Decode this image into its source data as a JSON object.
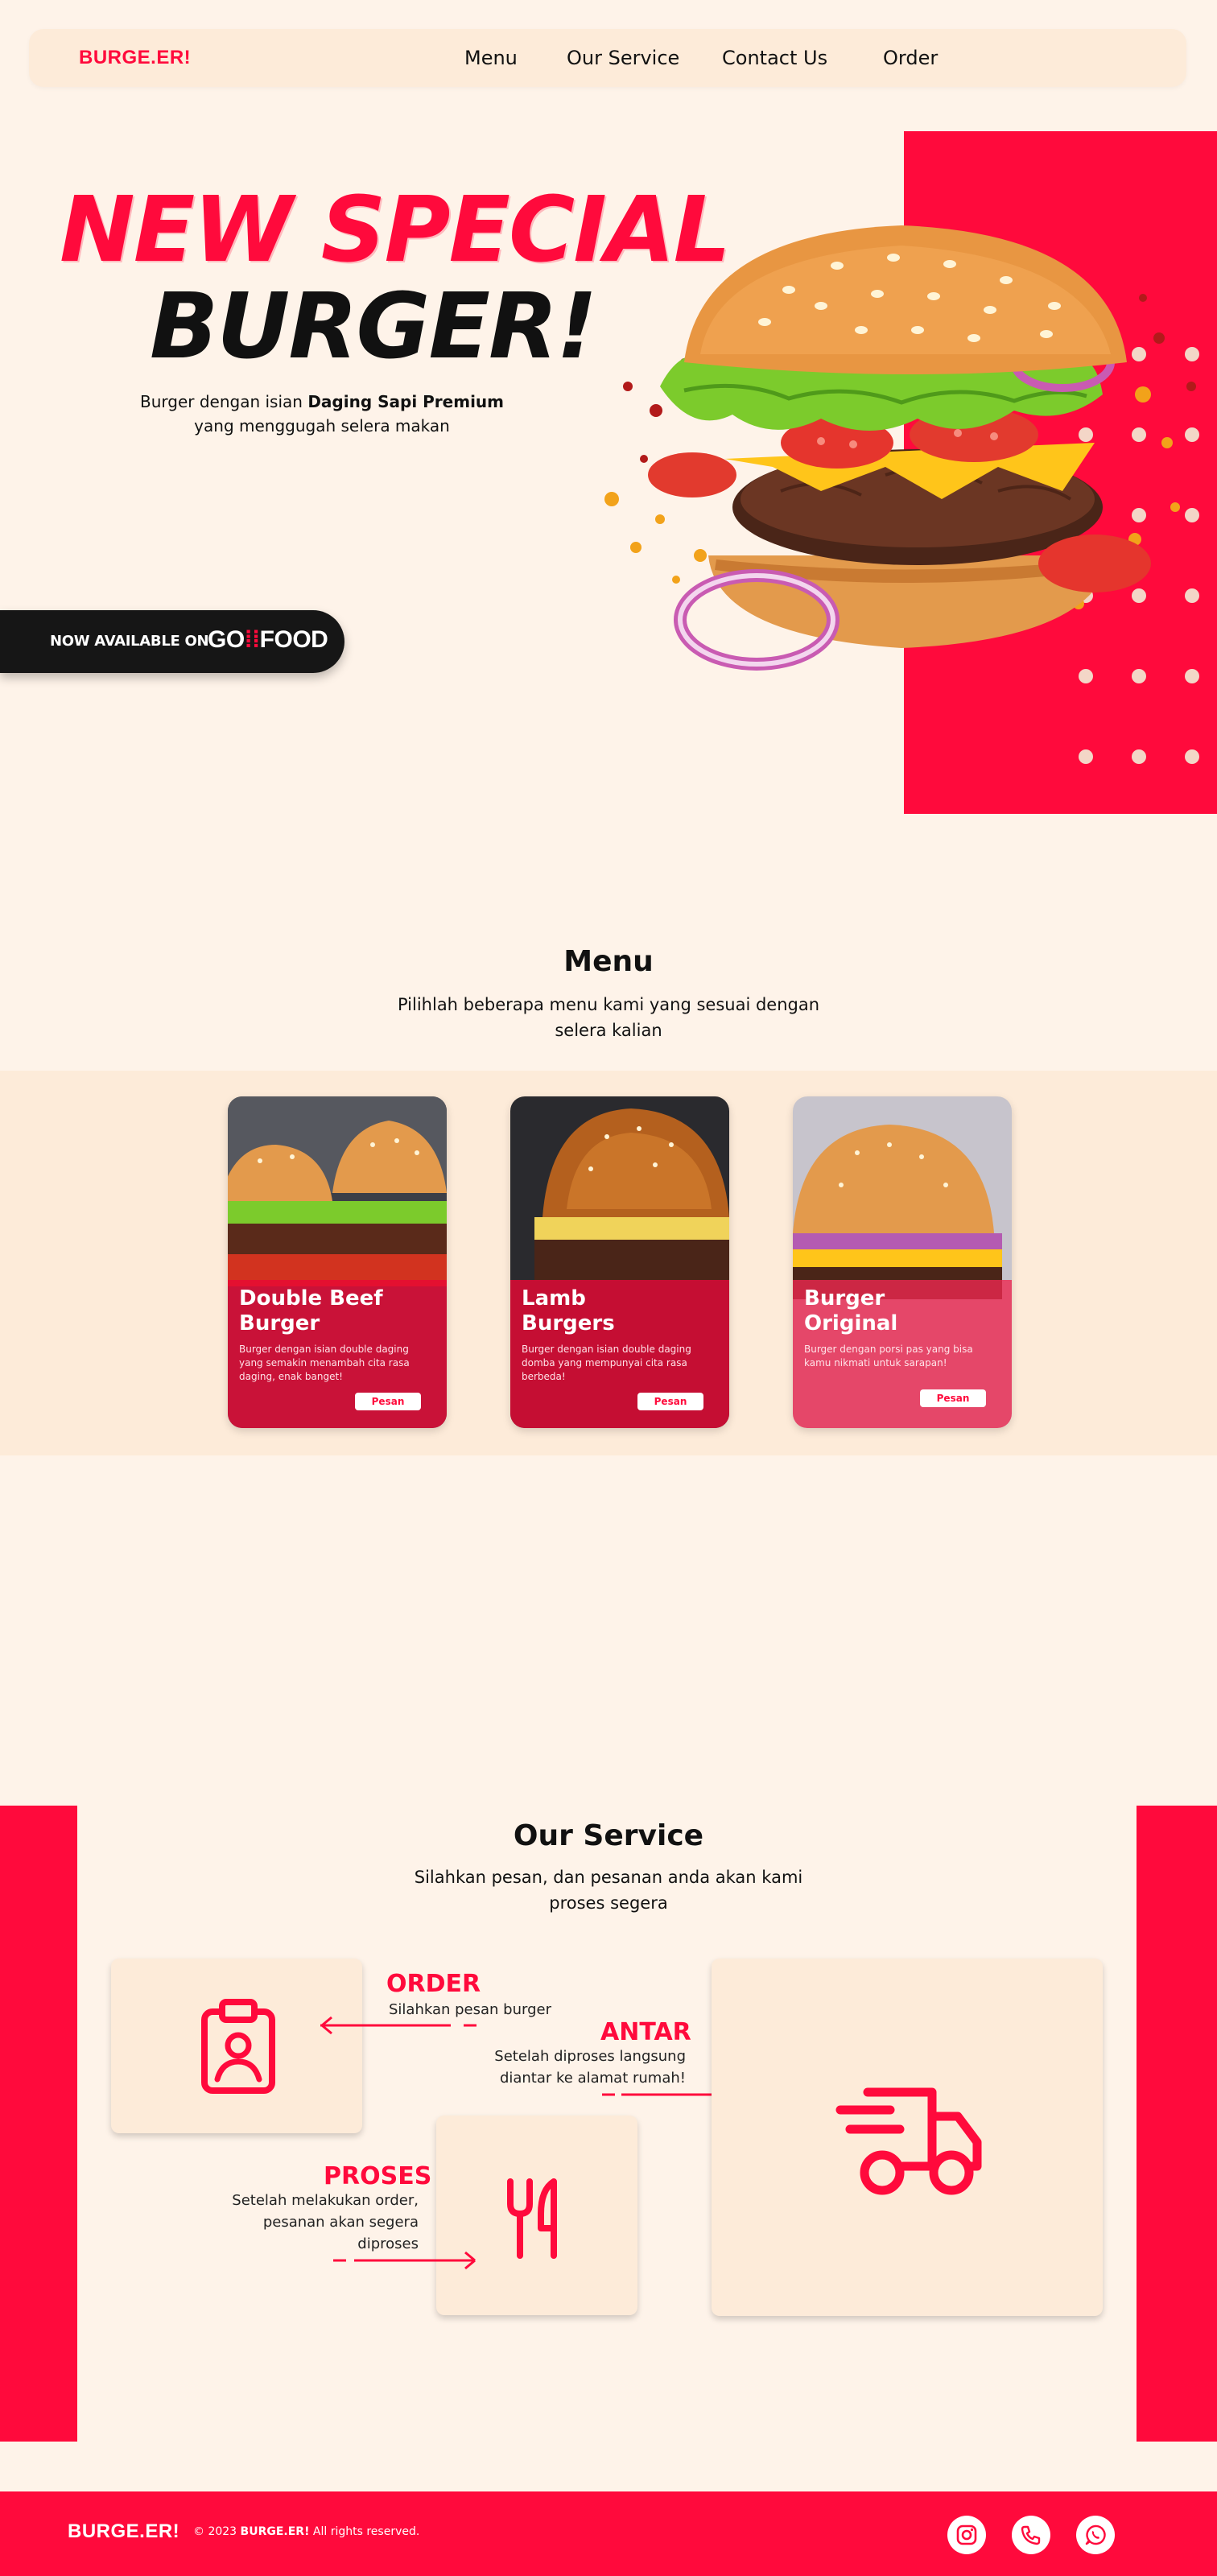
{
  "nav": {
    "brand": "BURGE.ER!",
    "links": [
      "Menu",
      "Our Service",
      "Contact Us",
      "Order"
    ]
  },
  "hero": {
    "title_line1": "NEW SPECIAL",
    "title_line2": "BURGER!",
    "desc_prefix": "Burger dengan isian ",
    "desc_bold": "Daging Sapi Premium",
    "desc_line2": "yang menggugah selera makan",
    "available_label": "NOW AVAILABLE ON",
    "gofood_go": "GO",
    "gofood_food": "FOOD"
  },
  "menu": {
    "title": "Menu",
    "subtitle_1": "Pilihlah beberapa menu kami yang sesuai dengan",
    "subtitle_2": "selera kalian",
    "cards": [
      {
        "title_1": "Double Beef",
        "title_2": "Burger",
        "desc": "Burger dengan isian double daging yang semakin menambah cita rasa daging, enak banget!",
        "button": "Pesan"
      },
      {
        "title_1": "Lamb",
        "title_2": "Burgers",
        "desc": "Burger dengan isian double daging domba yang mempunyai cita rasa berbeda!",
        "button": "Pesan"
      },
      {
        "title_1": "Burger",
        "title_2": "Original",
        "desc": "Burger dengan porsi pas yang bisa kamu nikmati untuk sarapan!",
        "button": "Pesan"
      }
    ]
  },
  "service": {
    "title": "Our Service",
    "subtitle_1": "Silahkan pesan, dan pesanan anda akan kami",
    "subtitle_2": "proses segera",
    "order_title": "ORDER",
    "order_desc": "Silahkan pesan burger",
    "antar_title": "ANTAR",
    "antar_desc_1": "Setelah diproses langsung",
    "antar_desc_2": "diantar ke alamat rumah!",
    "proses_title": "PROSES",
    "proses_desc_1": "Setelah melakukan order,",
    "proses_desc_2": "pesanan akan segera",
    "proses_desc_3": "diproses"
  },
  "footer": {
    "brand": "BURGE.ER!",
    "copy_prefix": "© 2023 ",
    "copy_brand": "BURGE.ER!",
    "copy_suffix": " All rights reserved."
  },
  "icons": [
    "instagram-icon",
    "phone-icon",
    "whatsapp-icon",
    "clipboard-user-icon",
    "fork-knife-icon",
    "delivery-truck-icon"
  ],
  "colors": {
    "accent": "#ff0a3c",
    "background": "#fef3e9",
    "panel": "#fdebd9",
    "dark": "#161616"
  }
}
